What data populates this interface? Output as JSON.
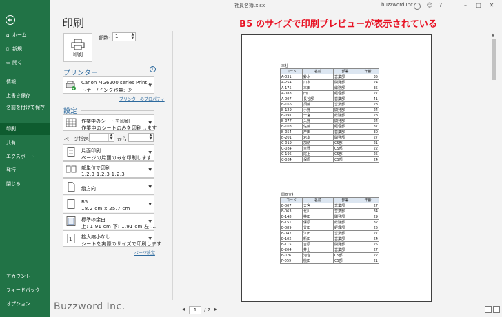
{
  "window": {
    "file_name": "社員名簿.xlsx",
    "user": "buzzword Inc.",
    "buttons": [
      "?",
      "–",
      "□",
      "✕"
    ]
  },
  "nav": {
    "top_items": [
      {
        "label": "ホーム",
        "icon": "home-icon"
      },
      {
        "label": "新規",
        "icon": "new-icon"
      },
      {
        "label": "開く",
        "icon": "open-icon"
      }
    ],
    "middle_items": [
      {
        "label": "情報"
      },
      {
        "label": "上書き保存"
      },
      {
        "label": "名前を付けて保存"
      },
      {
        "label": "印刷"
      },
      {
        "label": "共有"
      },
      {
        "label": "エクスポート"
      },
      {
        "label": "発行"
      },
      {
        "label": "閉じる"
      }
    ],
    "bottom_items": [
      {
        "label": "アカウント"
      },
      {
        "label": "フィードバック"
      },
      {
        "label": "オプション"
      }
    ],
    "active": "印刷"
  },
  "print_panel": {
    "title": "印刷",
    "print_button_label": "印刷",
    "copies_label": "部数:",
    "copies_value": "1",
    "printer_heading": "プリンター",
    "printer_name": "Canon MG6200 series Print…",
    "printer_status": "トナー/インク残量: 少",
    "printer_properties_link": "プリンターのプロパティ",
    "settings_heading": "設定",
    "settings": [
      {
        "l1": "作業中のシートを印刷",
        "l2": "作業中のシートのみを印刷します"
      },
      {
        "l1": "片面印刷",
        "l2": "ページの片面のみを印刷します"
      },
      {
        "l1": "部単位で印刷",
        "l2": "1,2,3    1,2,3    1,2,3"
      },
      {
        "l1": "縦方向",
        "l2": ""
      },
      {
        "l1": "B5",
        "l2": "18.2 cm x 25.7 cm"
      },
      {
        "l1": "標準の余白",
        "l2": "上: 1.91 cm 下: 1.91 cm 左:…"
      },
      {
        "l1": "拡大縮小なし",
        "l2": "シートを実際のサイズで印刷します"
      }
    ],
    "pages_label": "ページ指定:",
    "pages_to": "から",
    "page_setup_link": "ページ設定"
  },
  "annotation": "B5 のサイズで印刷プレビューが表示されている",
  "preview": {
    "headers": [
      "コード",
      "名前",
      "部署",
      "年齢"
    ],
    "block1": {
      "caption": "本社",
      "rows": [
        [
          "A-031",
          "鈴木",
          "営業部",
          "35"
        ],
        [
          "A-254",
          "川本",
          "開発部",
          "24"
        ],
        [
          "A-175",
          "本田",
          "総務部",
          "35"
        ],
        [
          "A-088",
          "田口",
          "経理部",
          "27"
        ],
        [
          "A-007",
          "長谷部",
          "営業部",
          "41"
        ],
        [
          "B-166",
          "須藤",
          "営業部",
          "23"
        ],
        [
          "B-129",
          "小野",
          "開発部",
          "24"
        ],
        [
          "B-091",
          "一宮",
          "総務部",
          "28"
        ],
        [
          "B-077",
          "入野",
          "開発部",
          "24"
        ],
        [
          "B-103",
          "佐藤",
          "経理部",
          "37"
        ],
        [
          "B-054",
          "芦田",
          "営業部",
          "30"
        ],
        [
          "B-201",
          "岩本",
          "開発部",
          "27"
        ],
        [
          "C-019",
          "加納",
          "CS部",
          "21"
        ],
        [
          "C-084",
          "吉野",
          "CS部",
          "22"
        ],
        [
          "C-195",
          "尾上",
          "CS部",
          "25"
        ],
        [
          "C-084",
          "保原",
          "CS部",
          "24"
        ]
      ]
    },
    "block2": {
      "caption": "関西支社",
      "rows": [
        [
          "E-007",
          "天宮",
          "営業部",
          "27"
        ],
        [
          "E-063",
          "北川",
          "営業部",
          "34"
        ],
        [
          "E-148",
          "神田",
          "開発部",
          "29"
        ],
        [
          "E-151",
          "保原",
          "総務部",
          "32"
        ],
        [
          "E-089",
          "曽田",
          "経理部",
          "25"
        ],
        [
          "E-047",
          "江田",
          "営業部",
          "27"
        ],
        [
          "E-102",
          "新田",
          "営業部",
          "24"
        ],
        [
          "E-115",
          "吉原",
          "開発部",
          "25"
        ],
        [
          "E-204",
          "井上",
          "営業部",
          "27"
        ],
        [
          "F-026",
          "河合",
          "CS部",
          "22"
        ],
        [
          "F-059",
          "桃田",
          "CS部",
          "21"
        ]
      ]
    }
  },
  "page_nav": {
    "current": "1",
    "total": "/ 2"
  },
  "watermark": "Buzzword Inc."
}
